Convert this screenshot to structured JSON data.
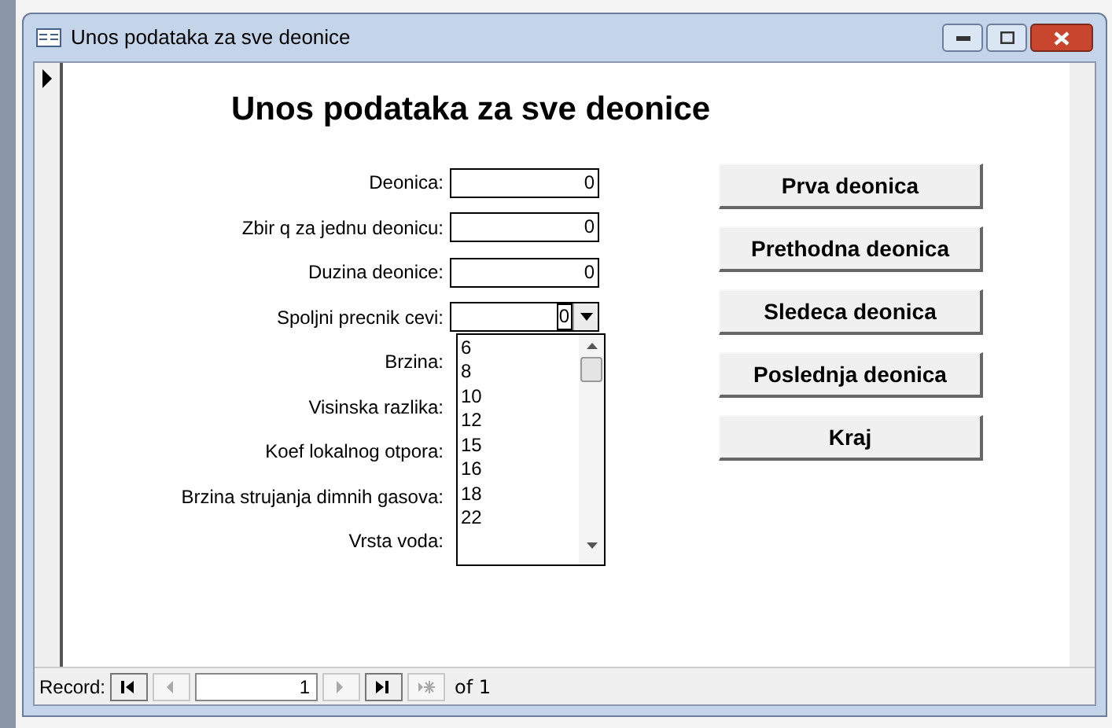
{
  "window": {
    "title": "Unos podataka za sve deonice"
  },
  "form": {
    "heading": "Unos podataka za sve deonice",
    "fields": [
      {
        "label": "Deonica:",
        "kind": "text",
        "value": "0"
      },
      {
        "label": "Zbir q za jednu deonicu:",
        "kind": "text",
        "value": "0"
      },
      {
        "label": "Duzina deonice:",
        "kind": "text",
        "value": "0"
      },
      {
        "label": "Spoljni precnik cevi:",
        "kind": "combo",
        "value": "0",
        "expanded": true
      },
      {
        "label": "Brzina:",
        "kind": "hidden"
      },
      {
        "label": "Visinska razlika:",
        "kind": "hidden"
      },
      {
        "label": "Koef lokalnog otpora:",
        "kind": "hidden"
      },
      {
        "label": "Brzina strujanja dimnih gasova:",
        "kind": "hidden"
      },
      {
        "label": "Vrsta voda:",
        "kind": "hidden"
      }
    ],
    "dropdown_options": [
      "6",
      "8",
      "10",
      "12",
      "15",
      "16",
      "18",
      "22"
    ],
    "buttons": [
      "Prva deonica",
      "Prethodna deonica",
      "Sledeca deonica",
      "Poslednja deonica",
      "Kraj"
    ]
  },
  "navigation": {
    "label": "Record:",
    "current": "1",
    "total": "of 1",
    "buttons": [
      {
        "kind": "first",
        "disabled": false
      },
      {
        "kind": "previous",
        "disabled": true
      },
      {
        "kind": "next",
        "disabled": true
      },
      {
        "kind": "last",
        "disabled": false
      },
      {
        "kind": "new",
        "disabled": true
      }
    ]
  }
}
